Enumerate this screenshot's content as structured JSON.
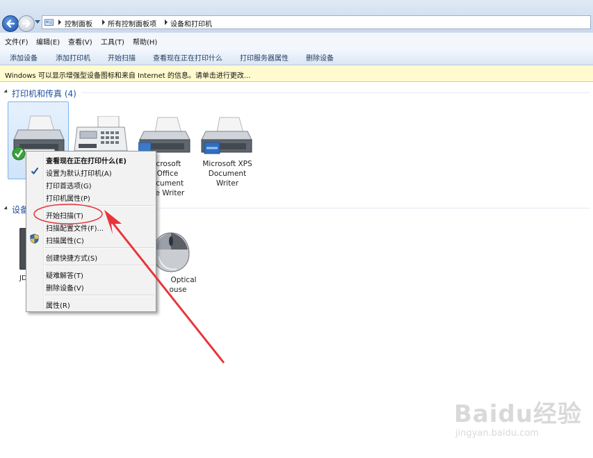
{
  "address": {
    "breadcrumbs": [
      "控制面板",
      "所有控制面板项",
      "设备和打印机"
    ]
  },
  "menu": {
    "items": [
      "文件(F)",
      "编辑(E)",
      "查看(V)",
      "工具(T)",
      "帮助(H)"
    ]
  },
  "commands": {
    "items": [
      "添加设备",
      "添加打印机",
      "开始扫描",
      "查看现在正在打印什么",
      "打印服务器属性",
      "删除设备"
    ]
  },
  "info_bar": {
    "text": "Windows 可以显示增强型设备图标和来自 Internet 的信息。请单击进行更改..."
  },
  "groups": {
    "printers": {
      "title": "打印机和传真 (4)"
    },
    "devices": {
      "title": "设备"
    }
  },
  "devices": {
    "printer3_label": [
      "icrosoft",
      "Office",
      "ocument",
      "ge Writer"
    ],
    "printer4_label": [
      "Microsoft XPS",
      "Document",
      "Writer"
    ],
    "device1_label": "JD",
    "mouse_label": [
      "Optical",
      "ouse"
    ]
  },
  "context_menu": {
    "items": [
      {
        "label": "查看现在正在打印什么(E)",
        "bold": true
      },
      {
        "label": "设置为默认打印机(A)",
        "checked": true
      },
      {
        "label": "打印首选项(G)"
      },
      {
        "label": "打印机属性(P)"
      },
      {
        "label": "开始扫描(T)",
        "highlighted": true
      },
      {
        "label": "扫描配置文件(F)..."
      },
      {
        "label": "扫描属性(C)",
        "shield": true
      },
      {
        "label": "创建快捷方式(S)"
      },
      {
        "label": "疑难解答(T)"
      },
      {
        "label": "删除设备(V)"
      },
      {
        "label": "属性(R)"
      }
    ]
  },
  "annotation": {
    "color": "#e8343a"
  },
  "watermark": {
    "text": "Baidu经验",
    "sub": "jingyan.baidu.com"
  }
}
